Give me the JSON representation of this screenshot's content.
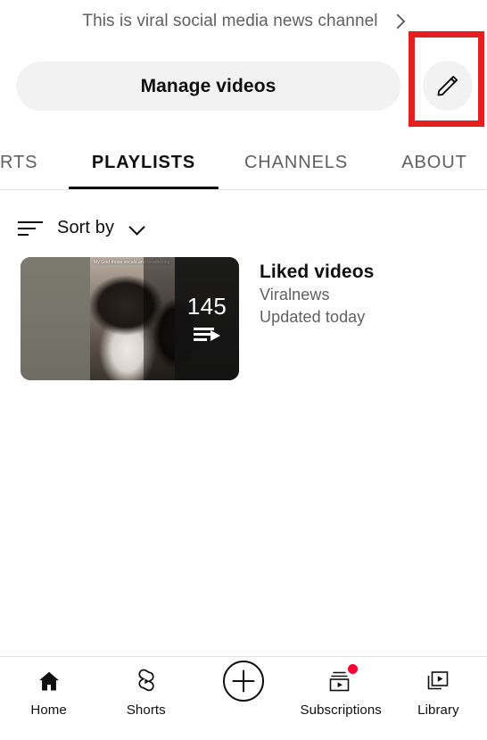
{
  "header": {
    "description": "This is viral social media news channel",
    "description_chevron": "chevron-right-icon",
    "manage_videos_label": "Manage videos",
    "edit_icon": "pencil-icon"
  },
  "annotation": {
    "color": "#e51f1f",
    "target": "edit-channel-button"
  },
  "tabs": [
    {
      "label": "ORTS",
      "name": "shorts",
      "active": false
    },
    {
      "label": "PLAYLISTS",
      "name": "playlists",
      "active": true
    },
    {
      "label": "CHANNELS",
      "name": "channels",
      "active": false
    },
    {
      "label": "ABOUT",
      "name": "about",
      "active": false
    }
  ],
  "sort": {
    "icon": "sort-lines-icon",
    "label": "Sort by",
    "chevron": "chevron-down-icon"
  },
  "playlists": [
    {
      "title": "Liked videos",
      "channel": "Viralnews",
      "updated": "Updated today",
      "video_count": "145",
      "thumbnail_caption": "My God those vocals and beatboxing",
      "overlay_icon": "playlist-play-icon"
    }
  ],
  "bottom_nav": [
    {
      "label": "Home",
      "icon": "home-icon",
      "badge": false
    },
    {
      "label": "Shorts",
      "icon": "shorts-icon",
      "badge": false
    },
    {
      "label": "",
      "icon": "plus-circle-icon",
      "badge": false
    },
    {
      "label": "Subscriptions",
      "icon": "subscriptions-icon",
      "badge": true
    },
    {
      "label": "Library",
      "icon": "library-icon",
      "badge": false
    }
  ],
  "colors": {
    "accent_red": "#ff0033",
    "annotation_red": "#e51f1f",
    "button_grey": "#f2f2f2",
    "text_primary": "#0f0f0f",
    "text_secondary": "#606060"
  }
}
